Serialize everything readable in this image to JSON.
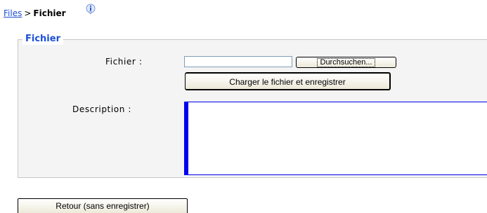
{
  "breadcrumb": {
    "parent": "Files",
    "separator": ">",
    "current": "Fichier"
  },
  "icons": {
    "info": "info-icon"
  },
  "colors": {
    "link": "#1a50d6",
    "legend": "#1a50d6",
    "textarea_border": "#0000ee",
    "fieldset_bg": "#f4f4f4"
  },
  "form": {
    "legend": "Fichier",
    "file_label": "Fichier :",
    "file_value": "",
    "browse_label": "Durchsuchen...",
    "upload_label": "Charger le fichier et enregistrer",
    "description_label": "Description :",
    "description_value": ""
  },
  "footer": {
    "back_label": "Retour (sans enregistrer)"
  }
}
